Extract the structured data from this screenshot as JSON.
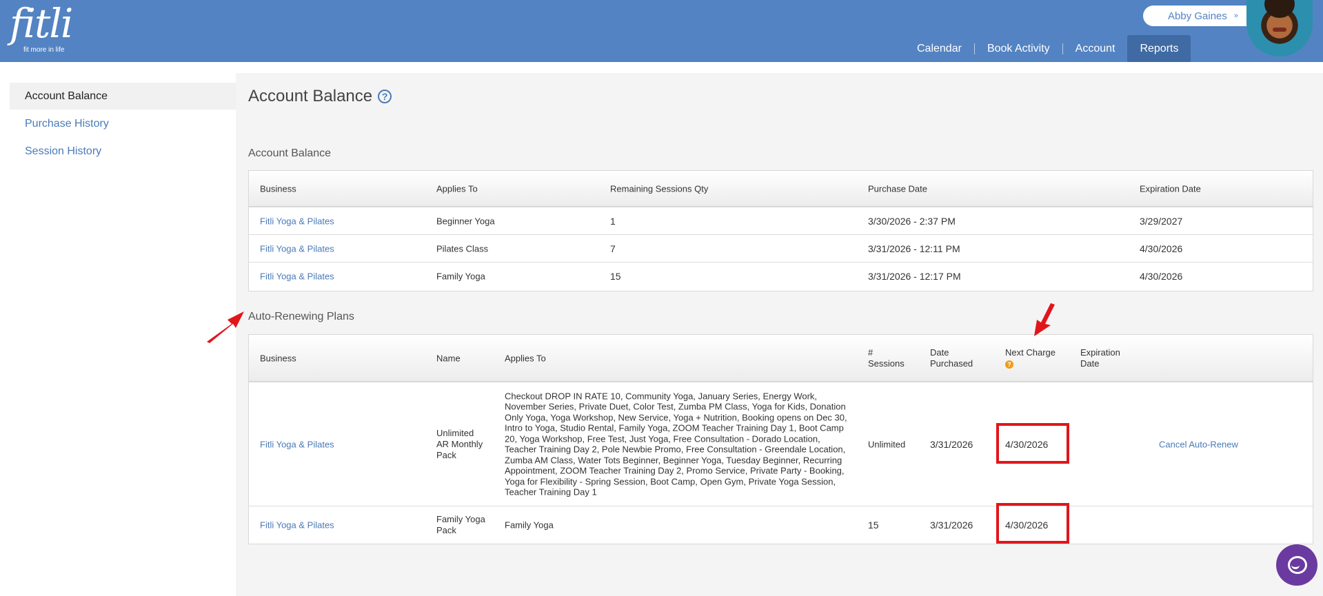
{
  "header": {
    "logo_text": "fitli",
    "logo_tagline": "fit more in life",
    "user_name": "Abby Gaines",
    "user_chevron": "»",
    "nav": [
      "Calendar",
      "Book Activity",
      "Account",
      "Reports"
    ]
  },
  "sidebar": {
    "items": [
      "Account Balance",
      "Purchase History",
      "Session History"
    ]
  },
  "page": {
    "title": "Account Balance",
    "help": "?"
  },
  "balance": {
    "title": "Account Balance",
    "headers": [
      "Business",
      "Applies To",
      "Remaining Sessions Qty",
      "Purchase Date",
      "Expiration Date"
    ],
    "rows": [
      {
        "business": "Fitli Yoga & Pilates",
        "applies": "Beginner Yoga",
        "qty": "1",
        "purchase": "3/30/2026 - 2:37 PM",
        "expires": "3/29/2027"
      },
      {
        "business": "Fitli Yoga & Pilates",
        "applies": "Pilates Class",
        "qty": "7",
        "purchase": "3/31/2026 - 12:11 PM",
        "expires": "4/30/2026"
      },
      {
        "business": "Fitli Yoga & Pilates",
        "applies": "Family Yoga",
        "qty": "15",
        "purchase": "3/31/2026 - 12:17 PM",
        "expires": "4/30/2026"
      }
    ]
  },
  "plans": {
    "title": "Auto-Renewing Plans",
    "headers": {
      "business": "Business",
      "name": "Name",
      "applies": "Applies To",
      "sessions_1": "#",
      "sessions_2": "Sessions",
      "purchased_1": "Date",
      "purchased_2": "Purchased",
      "next_charge": "Next Charge",
      "expiration_1": "Expiration",
      "expiration_2": "Date"
    },
    "rows": [
      {
        "business": "Fitli Yoga & Pilates",
        "name": "Unlimited AR Monthly Pack",
        "applies": "Checkout DROP IN RATE 10, Community Yoga, January Series, Energy Work, November Series, Private Duet, Color Test, Zumba PM Class, Yoga for Kids, Donation Only Yoga, Yoga Workshop, New Service, Yoga + Nutrition, Booking opens on Dec 30, Intro to Yoga, Studio Rental, Family Yoga, ZOOM Teacher Training Day 1, Boot Camp 20, Yoga Workshop, Free Test, Just Yoga, Free Consultation - Dorado Location, Teacher Training Day 2, Pole Newbie Promo, Free Consultation - Greendale Location, Zumba AM Class, Water Tots Beginner, Beginner Yoga, Tuesday Beginner, Recurring Appointment, ZOOM Teacher Training Day 2, Promo Service, Private Party - Booking, Yoga for Flexibility - Spring Session, Boot Camp, Open Gym, Private Yoga Session, Teacher Training Day 1",
        "sessions": "Unlimited",
        "purchased": "3/31/2026",
        "next_charge": "4/30/2026",
        "expiration": "",
        "action": "Cancel Auto-Renew"
      },
      {
        "business": "Fitli Yoga & Pilates",
        "name": "Family Yoga Pack",
        "applies": "Family Yoga",
        "sessions": "15",
        "purchased": "3/31/2026",
        "next_charge": "4/30/2026",
        "expiration": "",
        "action": ""
      }
    ]
  },
  "colors": {
    "header": "#5383c2",
    "link": "#4a7ab8",
    "annotation": "#e0161b"
  }
}
